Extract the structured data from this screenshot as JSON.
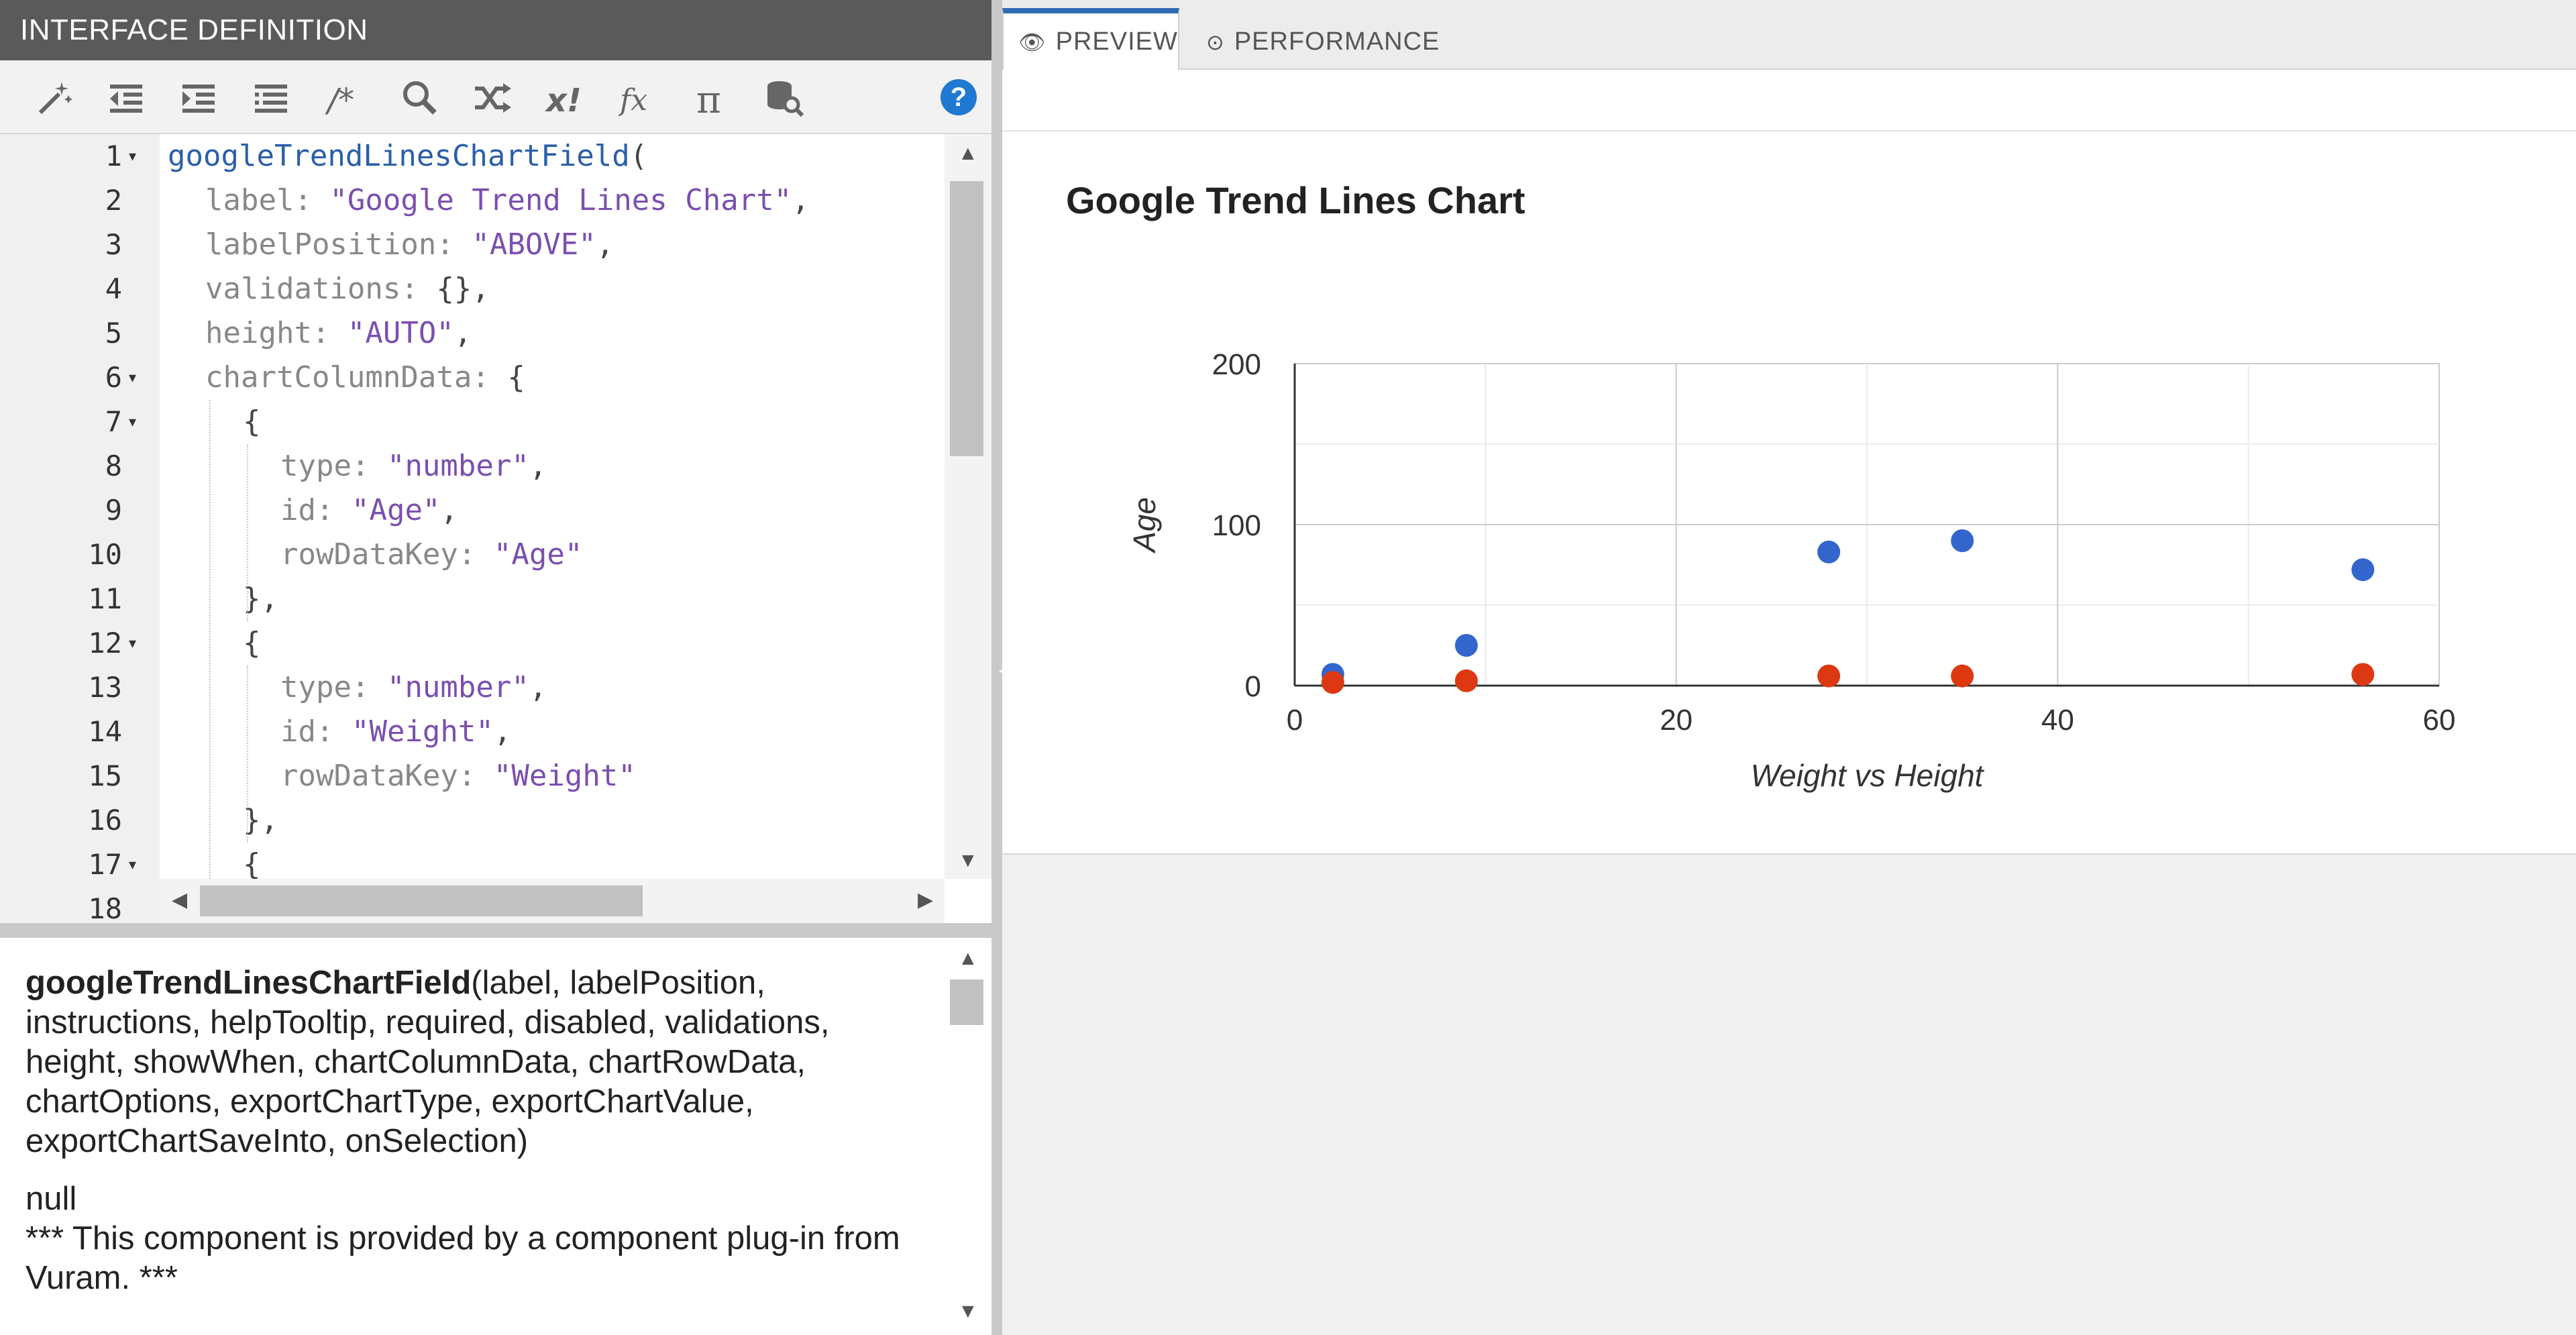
{
  "left_panel": {
    "title": "INTERFACE DEFINITION",
    "toolbar": {
      "tools": [
        "magic-wand-icon",
        "outdent-icon",
        "indent-icon",
        "list-icon",
        "comment-icon",
        "search-icon",
        "shuffle-icon",
        "expression-icon",
        "function-icon",
        "pi-icon",
        "data-search-icon"
      ],
      "help_label": "?"
    },
    "editor": {
      "line_numbers": [
        "1",
        "2",
        "3",
        "4",
        "5",
        "6",
        "7",
        "8",
        "9",
        "10",
        "11",
        "12",
        "13",
        "14",
        "15",
        "16",
        "17",
        "18"
      ],
      "folded_lines": [
        1,
        6,
        7,
        12,
        17
      ],
      "lines": [
        {
          "indent": 0,
          "parts": [
            {
              "t": "fn",
              "v": "googleTrendLinesChartField"
            },
            {
              "t": "p",
              "v": "("
            }
          ]
        },
        {
          "indent": 1,
          "parts": [
            {
              "t": "k",
              "v": "label: "
            },
            {
              "t": "str",
              "v": "\"Google Trend Lines Chart\""
            },
            {
              "t": "p",
              "v": ","
            }
          ]
        },
        {
          "indent": 1,
          "parts": [
            {
              "t": "k",
              "v": "labelPosition: "
            },
            {
              "t": "str",
              "v": "\"ABOVE\""
            },
            {
              "t": "p",
              "v": ","
            }
          ]
        },
        {
          "indent": 1,
          "parts": [
            {
              "t": "k",
              "v": "validations: "
            },
            {
              "t": "p",
              "v": "{},"
            }
          ]
        },
        {
          "indent": 1,
          "parts": [
            {
              "t": "k",
              "v": "height: "
            },
            {
              "t": "str",
              "v": "\"AUTO\""
            },
            {
              "t": "p",
              "v": ","
            }
          ]
        },
        {
          "indent": 1,
          "parts": [
            {
              "t": "k",
              "v": "chartColumnData: "
            },
            {
              "t": "p",
              "v": "{"
            }
          ]
        },
        {
          "indent": 2,
          "parts": [
            {
              "t": "p",
              "v": "{"
            }
          ]
        },
        {
          "indent": 3,
          "parts": [
            {
              "t": "k",
              "v": "type: "
            },
            {
              "t": "str",
              "v": "\"number\""
            },
            {
              "t": "p",
              "v": ","
            }
          ]
        },
        {
          "indent": 3,
          "parts": [
            {
              "t": "k",
              "v": "id: "
            },
            {
              "t": "str",
              "v": "\"Age\""
            },
            {
              "t": "p",
              "v": ","
            }
          ]
        },
        {
          "indent": 3,
          "parts": [
            {
              "t": "k",
              "v": "rowDataKey: "
            },
            {
              "t": "str",
              "v": "\"Age\""
            }
          ]
        },
        {
          "indent": 2,
          "parts": [
            {
              "t": "p",
              "v": "},"
            }
          ]
        },
        {
          "indent": 2,
          "parts": [
            {
              "t": "p",
              "v": "{"
            }
          ]
        },
        {
          "indent": 3,
          "parts": [
            {
              "t": "k",
              "v": "type: "
            },
            {
              "t": "str",
              "v": "\"number\""
            },
            {
              "t": "p",
              "v": ","
            }
          ]
        },
        {
          "indent": 3,
          "parts": [
            {
              "t": "k",
              "v": "id: "
            },
            {
              "t": "str",
              "v": "\"Weight\""
            },
            {
              "t": "p",
              "v": ","
            }
          ]
        },
        {
          "indent": 3,
          "parts": [
            {
              "t": "k",
              "v": "rowDataKey: "
            },
            {
              "t": "str",
              "v": "\"Weight\""
            }
          ]
        },
        {
          "indent": 2,
          "parts": [
            {
              "t": "p",
              "v": "},"
            }
          ]
        },
        {
          "indent": 2,
          "parts": [
            {
              "t": "p",
              "v": "{"
            }
          ]
        }
      ]
    },
    "doc": {
      "function_name": "googleTrendLinesChartField",
      "signature": "(label, labelPosition, instructions, helpTooltip, required, disabled, validations, height, showWhen, chartColumnData, chartRowData, chartOptions, exportChartType, exportChartValue, exportChartSaveInto, onSelection)",
      "return_value": "null",
      "note": "*** This component is provided by a component plug-in from Vuram. ***"
    }
  },
  "right_panel": {
    "tabs": [
      {
        "label": "PREVIEW",
        "icon": "eye-icon",
        "active": true
      },
      {
        "label": "PERFORMANCE",
        "icon": "clock-icon",
        "active": false
      }
    ],
    "chart_title": "Google Trend Lines Chart"
  },
  "colors": {
    "series_blue": "#3366cc",
    "series_red": "#dc3912",
    "active_tab": "#2f6bb3",
    "header_bg": "#5a5a5a"
  },
  "chart_data": {
    "type": "scatter",
    "title": "Google Trend Lines Chart",
    "xlabel": "Weight vs Height",
    "ylabel": "Age",
    "xlim": [
      0,
      60
    ],
    "ylim": [
      0,
      200
    ],
    "x_ticks": [
      "0",
      "20",
      "40",
      "60"
    ],
    "y_ticks": [
      "0",
      "100",
      "200"
    ],
    "grid": true,
    "legend": "none",
    "series": [
      {
        "color": "#3366cc",
        "points": [
          [
            2,
            7
          ],
          [
            9,
            25
          ],
          [
            28,
            83
          ],
          [
            35,
            90
          ],
          [
            56,
            72
          ]
        ]
      },
      {
        "color": "#dc3912",
        "points": [
          [
            2,
            2
          ],
          [
            9,
            3
          ],
          [
            28,
            6
          ],
          [
            35,
            6
          ],
          [
            56,
            7
          ]
        ]
      }
    ]
  }
}
